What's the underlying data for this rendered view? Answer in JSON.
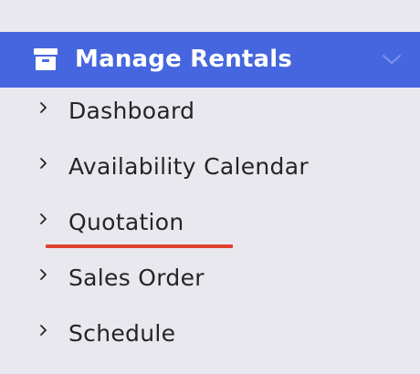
{
  "menu": {
    "title": "Manage Rentals",
    "header_icon": "archive-box-icon",
    "expand_icon": "chevron-down-icon",
    "accent_color": "#4566de",
    "items": [
      {
        "label": "Dashboard",
        "icon": "chevron-right-icon"
      },
      {
        "label": "Availability Calendar",
        "icon": "chevron-right-icon"
      },
      {
        "label": "Quotation",
        "icon": "chevron-right-icon",
        "highlighted": true
      },
      {
        "label": "Sales Order",
        "icon": "chevron-right-icon"
      },
      {
        "label": "Schedule",
        "icon": "chevron-right-icon"
      }
    ],
    "highlight_color": "#e0402e"
  }
}
